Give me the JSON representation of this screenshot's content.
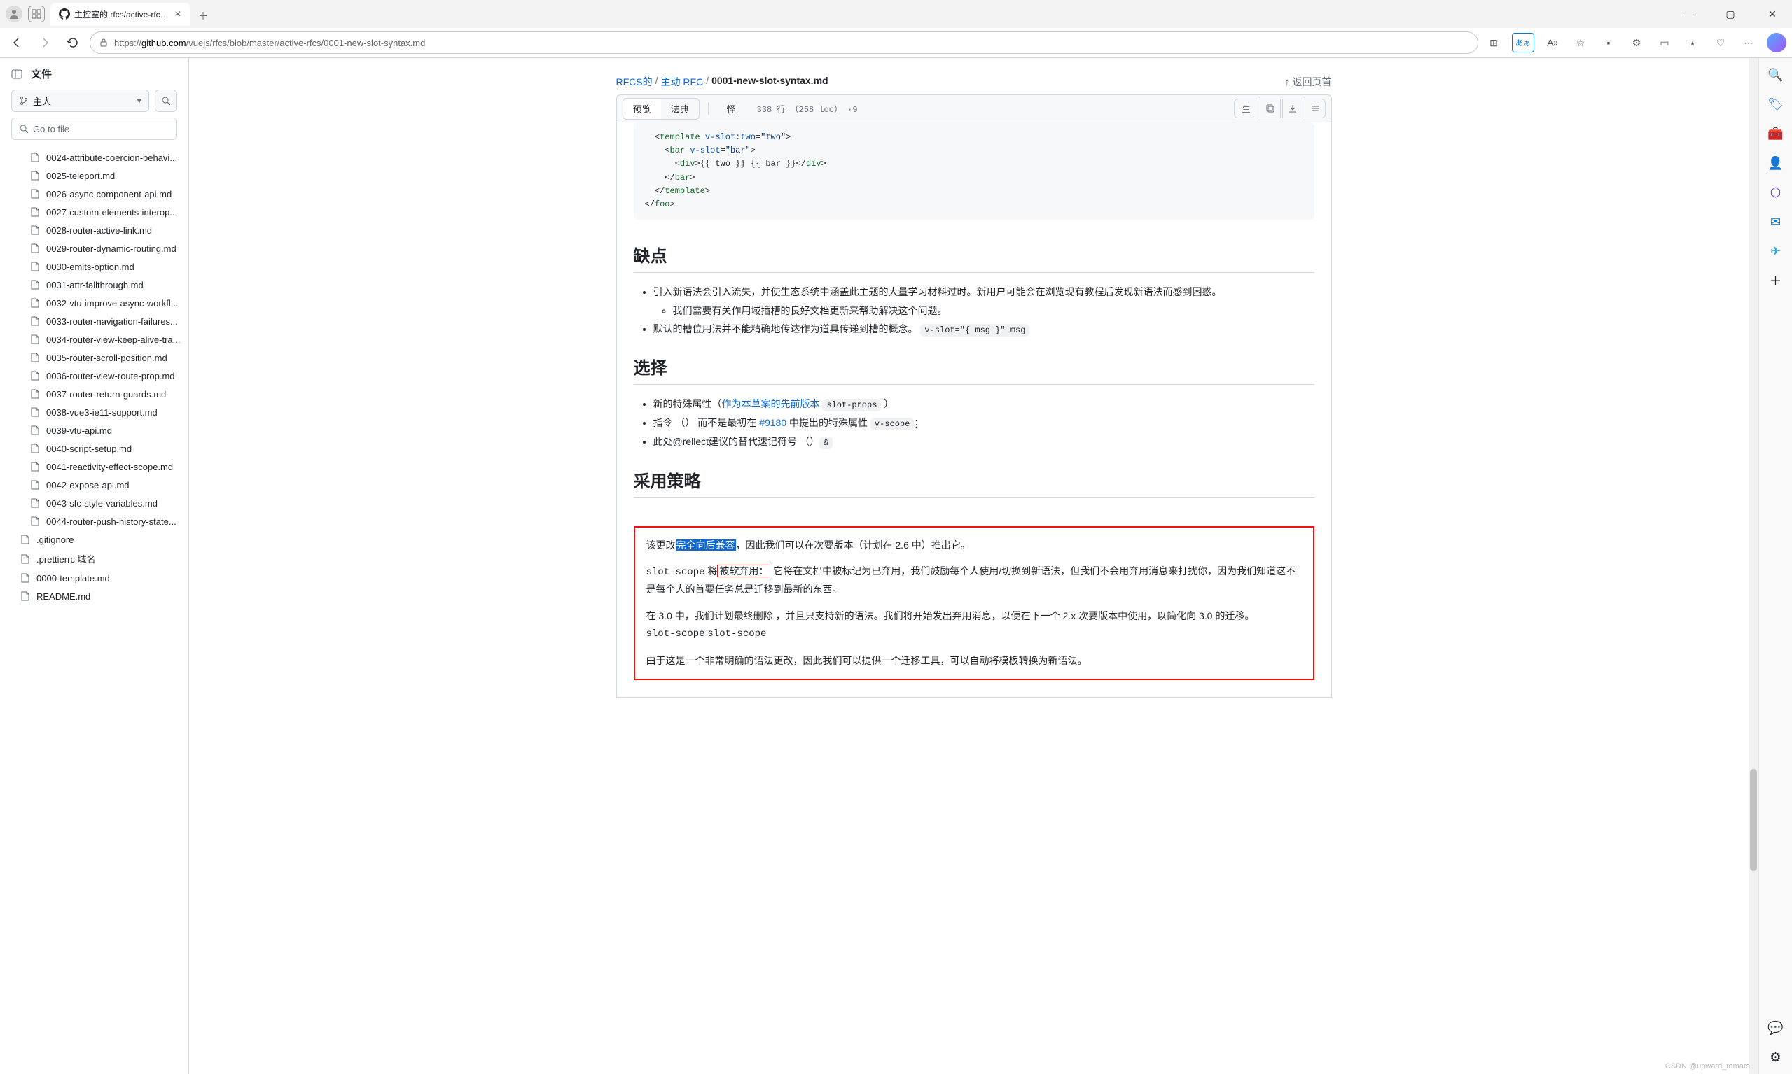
{
  "browser": {
    "tab_title": "主控室的 rfcs/active-rfcs/0001-n...",
    "url_prefix": "https://",
    "url_host": "github.com",
    "url_path": "/vuejs/rfcs/blob/master/active-rfcs/0001-new-slot-syntax.md"
  },
  "files_panel": {
    "title": "文件",
    "branch": "主人",
    "search_placeholder": "Go to file",
    "items": [
      "0024-attribute-coercion-behavi...",
      "0025-teleport.md",
      "0026-async-component-api.md",
      "0027-custom-elements-interop...",
      "0028-router-active-link.md",
      "0029-router-dynamic-routing.md",
      "0030-emits-option.md",
      "0031-attr-fallthrough.md",
      "0032-vtu-improve-async-workfl...",
      "0033-router-navigation-failures...",
      "0034-router-view-keep-alive-tra...",
      "0035-router-scroll-position.md",
      "0036-router-view-route-prop.md",
      "0037-router-return-guards.md",
      "0038-vue3-ie11-support.md",
      "0039-vtu-api.md",
      "0040-script-setup.md",
      "0041-reactivity-effect-scope.md",
      "0042-expose-api.md",
      "0043-sfc-style-variables.md",
      "0044-router-push-history-state..."
    ],
    "root_items": [
      ".gitignore",
      ".prettierrc 域名",
      "0000-template.md",
      "README.md"
    ]
  },
  "breadcrumb": {
    "root": "RFCS的",
    "mid": "主动 RFC",
    "current": "0001-new-slot-syntax.md",
    "top_link": "返回页首"
  },
  "toolbar": {
    "preview": "预览",
    "code": "法典",
    "blame": "怪",
    "info": "338 行 （258 loc） ·9"
  },
  "content": {
    "h_drawbacks": "缺点",
    "drawback1": "引入新语法会引入流失，并使生态系统中涵盖此主题的大量学习材料过时。新用户可能会在浏览现有教程后发现新语法而感到困惑。",
    "drawback1_sub": "我们需要有关作用域插槽的良好文档更新来帮助解决这个问题。",
    "drawback2_a": "默认的槽位用法并不能精确地传达作为道具传递到槽的概念。",
    "drawback2_code": "v-slot=\"{ msg }\" msg",
    "h_choice": "选择",
    "choice1_a": "新的特殊属性（",
    "choice1_link": "作为本草案的先前版本",
    "choice1_code": "slot-props",
    "choice1_b": "）",
    "choice2_a": "指令 （） 而不是最初在 ",
    "choice2_link": "#9180",
    "choice2_b": " 中提出的特殊属性 ",
    "choice2_code": "v-scope",
    "choice2_c": "；",
    "choice3_a": "此处@rellect建议的替代速记符号 （）",
    "choice3_code": "&",
    "h_adopt": "采用策略",
    "adopt_p1_a": "该更改",
    "adopt_p1_hl": "完全向后兼容",
    "adopt_p1_b": "，因此我们可以在次要版本（计划在 2.6 中）推出它。",
    "adopt_p2_code": "slot-scope",
    "adopt_p2_a": " 将",
    "adopt_p2_box": "被软弃用：",
    "adopt_p2_b": "它将在文档中被标记为已弃用，我们鼓励每个人使用/切换到新语法，但我们不会用弃用消息来打扰你，因为我们知道这不是每个人的首要任务总是迁移到最新的东西。",
    "adopt_p3_a": "在 3.0 中，我们计划最终删除 ，并且只支持新的语法。我们将开始发出弃用消息，以便在下一个 2.x 次要版本中使用，以简化向 3.0 的迁移。",
    "adopt_p3_code1": "slot-scope",
    "adopt_p3_code2": "slot-scope",
    "adopt_p4": "由于这是一个非常明确的语法更改，因此我们可以提供一个迁移工具，可以自动将模板转换为新语法。"
  },
  "watermark": "CSDN @upward_tomato"
}
